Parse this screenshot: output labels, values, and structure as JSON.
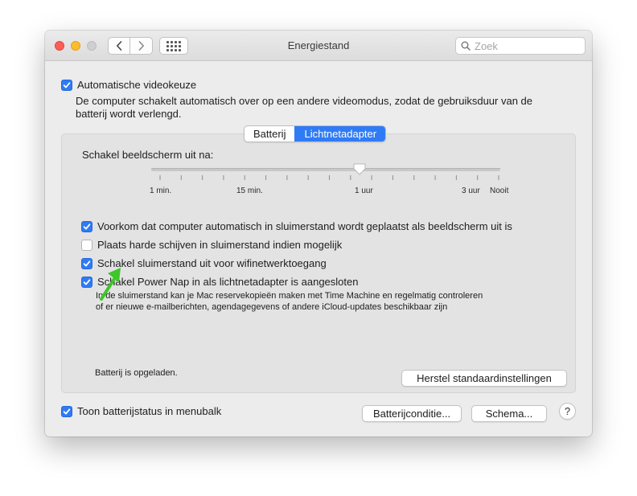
{
  "window": {
    "title": "Energiestand",
    "search_placeholder": "Zoek"
  },
  "auto_graphics": {
    "label": "Automatische videokeuze",
    "checked": true,
    "description_line1": "De computer schakelt automatisch over op een andere videomodus, zodat de gebruiksduur van de",
    "description_line2": "batterij wordt verlengd."
  },
  "tabs": [
    {
      "label": "Batterij",
      "active": false
    },
    {
      "label": "Lichtnetadapter",
      "active": true
    }
  ],
  "display_sleep": {
    "label": "Schakel beeldscherm uit na:",
    "ticks": [
      "1 min.",
      "15 min.",
      "1 uur",
      "3 uur",
      "Nooit"
    ],
    "value": "1 uur"
  },
  "options": [
    {
      "label": "Voorkom dat computer automatisch in sluimerstand wordt geplaatst als beeldscherm uit is",
      "checked": true
    },
    {
      "label": "Plaats harde schijven in sluimerstand indien mogelijk",
      "checked": false
    },
    {
      "label": "Schakel sluimerstand uit voor wifinetwerktoegang",
      "checked": true
    },
    {
      "label": "Schakel Power Nap in als lichtnetadapter is aangesloten",
      "checked": true
    }
  ],
  "power_nap_desc": {
    "line1": "In de sluimerstand kan je Mac reservekopieën maken met Time Machine en regelmatig controleren",
    "line2": "of er nieuwe e-mailberichten, agendagegevens of andere iCloud-updates beschikbaar zijn"
  },
  "battery_status": "Batterij is opgeladen.",
  "restore_button": "Herstel standaardinstellingen",
  "menubar_status": {
    "label": "Toon batterijstatus in menubalk",
    "checked": true
  },
  "buttons": {
    "battery_condition": "Batterijconditie...",
    "schedule": "Schema...",
    "help": "?"
  },
  "colors": {
    "accent": "#2f7bf5",
    "annotation_arrow": "#3ec62a"
  },
  "icons": {
    "back": "chevron-left-icon",
    "forward": "chevron-right-icon",
    "grid": "grid-icon",
    "search": "search-icon",
    "arrow": "arrow-annotation-icon"
  }
}
